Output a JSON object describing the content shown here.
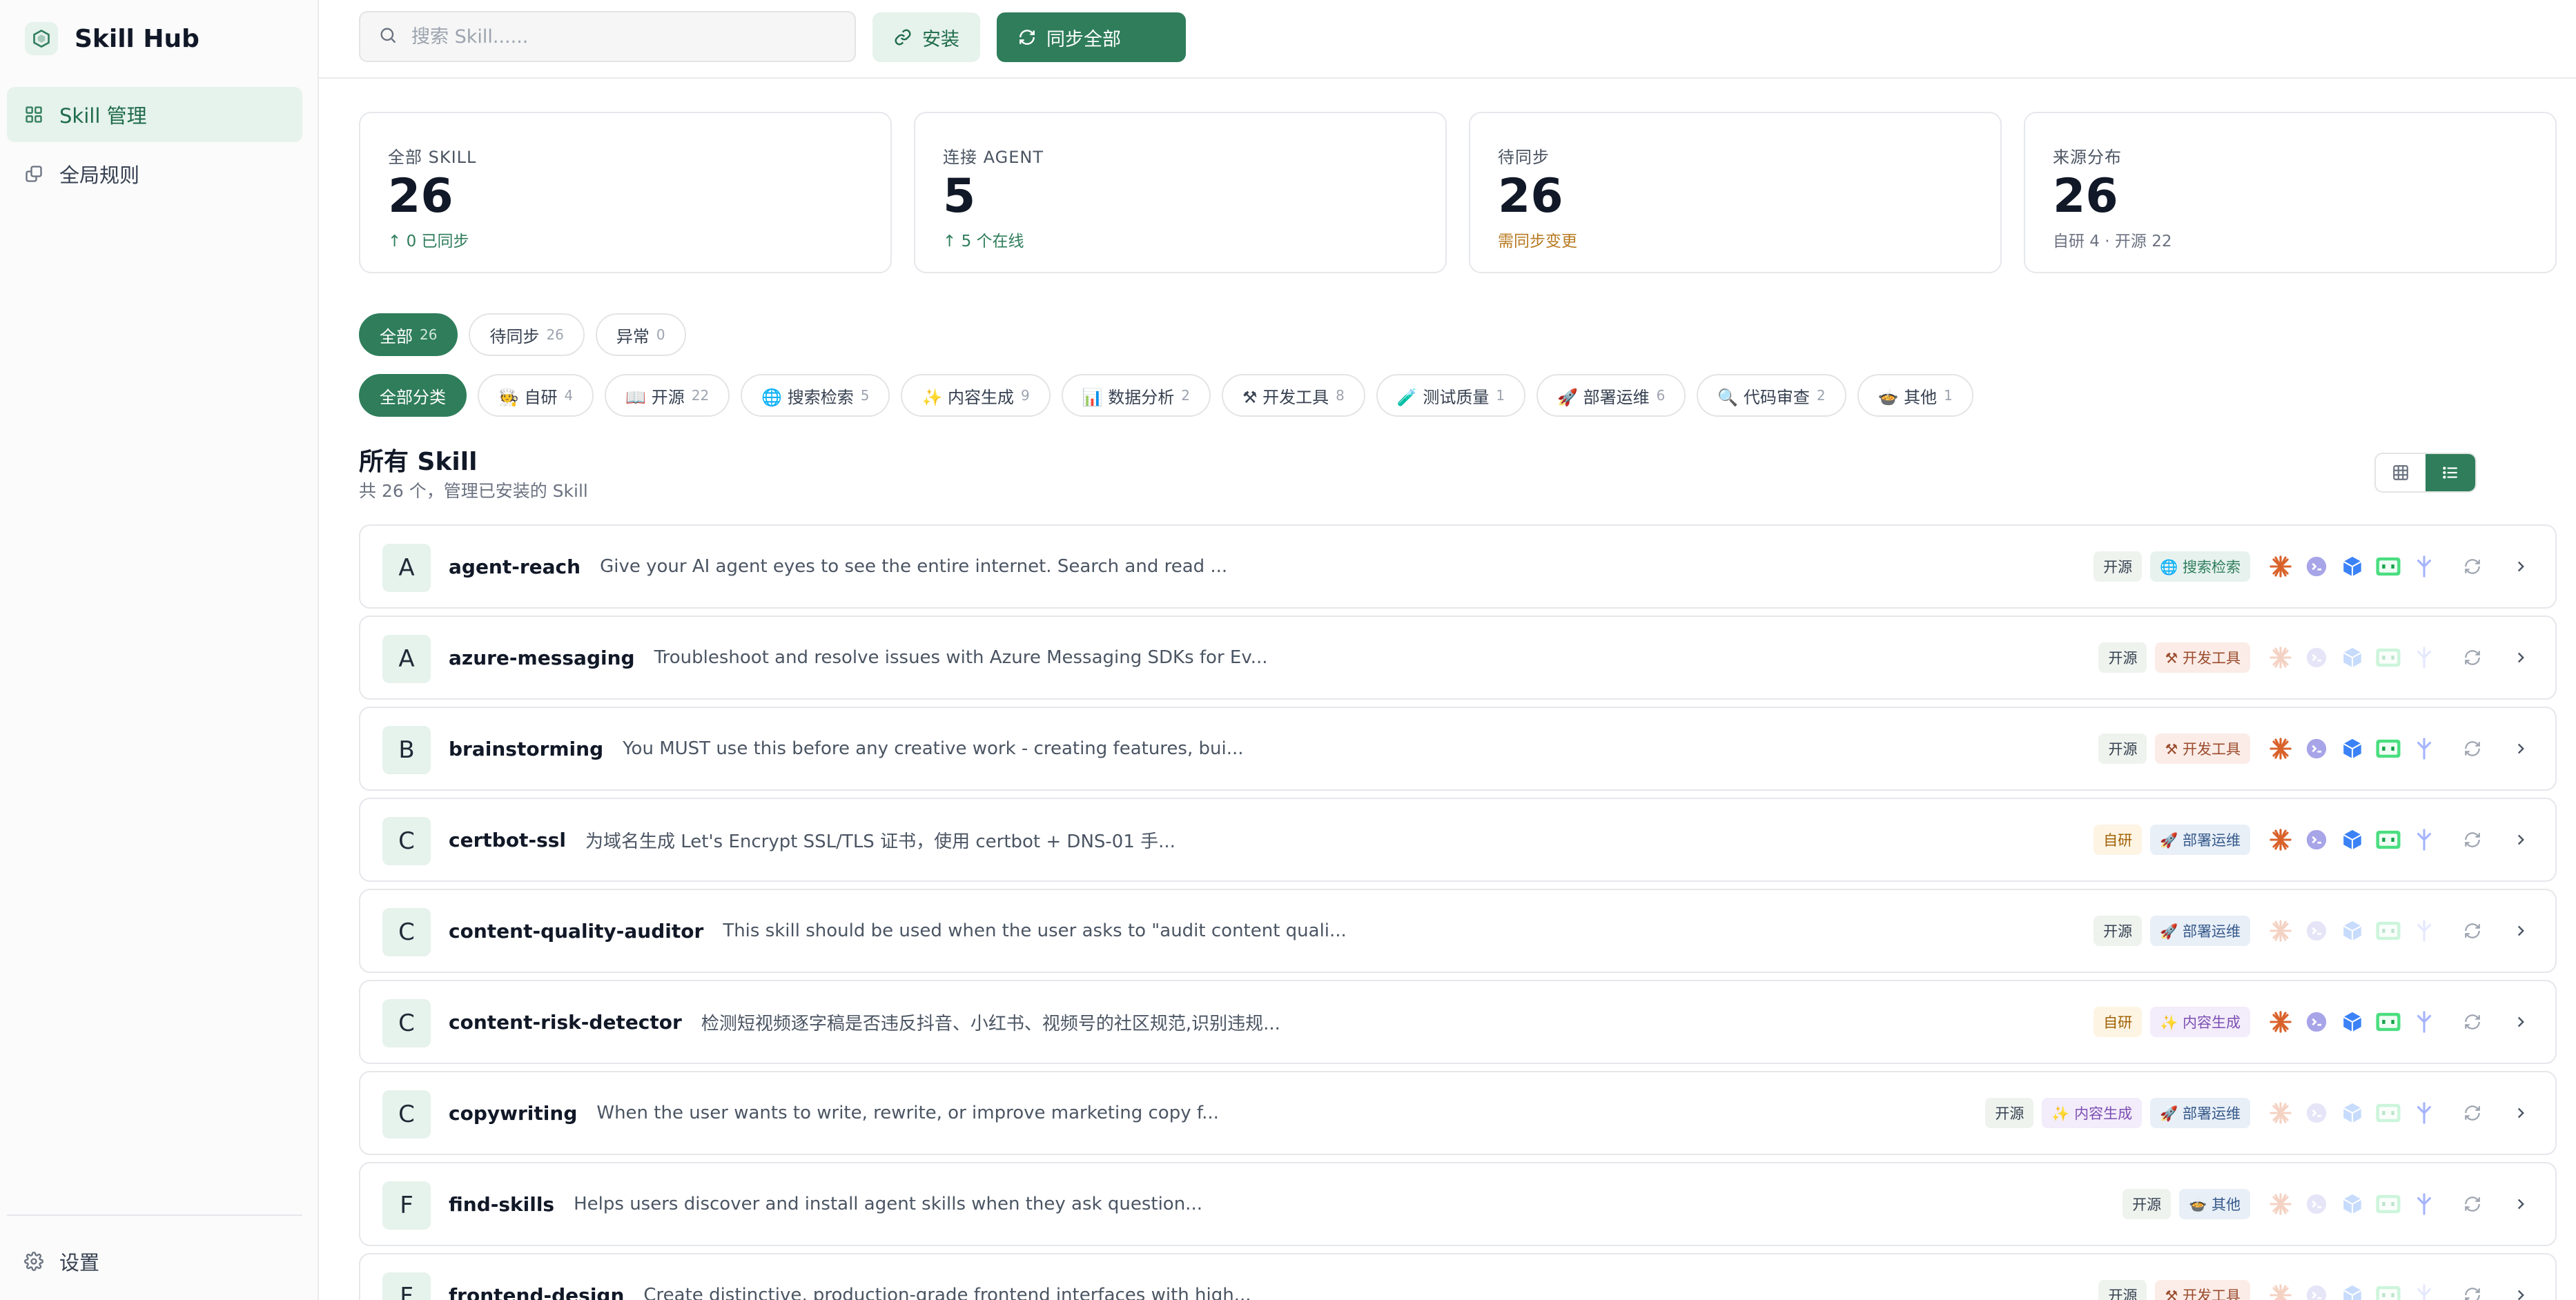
{
  "app": {
    "title": "Skill Hub"
  },
  "sidebar": {
    "items": [
      {
        "label": "Skill 管理",
        "icon": "grid-icon",
        "active": true
      },
      {
        "label": "全局规则",
        "icon": "copy-icon",
        "active": false
      }
    ],
    "footer": {
      "label": "设置",
      "icon": "gear-icon"
    }
  },
  "topbar": {
    "search_placeholder": "搜索 Skill......",
    "install_label": "安装",
    "sync_all_label": "同步全部"
  },
  "stats": [
    {
      "label": "全部 SKILL",
      "value": "26",
      "sub": "↑ 0 已同步",
      "tone": "green"
    },
    {
      "label": "连接 AGENT",
      "value": "5",
      "sub": "↑ 5 个在线",
      "tone": "green"
    },
    {
      "label": "待同步",
      "value": "26",
      "sub": "需同步变更",
      "tone": "amber"
    },
    {
      "label": "来源分布",
      "value": "26",
      "sub": "自研 4 · 开源 22",
      "tone": "gray"
    }
  ],
  "status_filters": [
    {
      "label": "全部",
      "count": "26",
      "active": true
    },
    {
      "label": "待同步",
      "count": "26",
      "active": false
    },
    {
      "label": "异常",
      "count": "0",
      "active": false
    }
  ],
  "category_filters": [
    {
      "label": "全部分类",
      "count": "",
      "active": true
    },
    {
      "label": "🧑‍🍳 自研",
      "count": "4"
    },
    {
      "label": "📖 开源",
      "count": "22"
    },
    {
      "label": "🌐 搜索检索",
      "count": "5"
    },
    {
      "label": "✨ 内容生成",
      "count": "9"
    },
    {
      "label": "📊 数据分析",
      "count": "2"
    },
    {
      "label": "⚒ 开发工具",
      "count": "8"
    },
    {
      "label": "🧪 测试质量",
      "count": "1"
    },
    {
      "label": "🚀 部署运维",
      "count": "6"
    },
    {
      "label": "🔍 代码审查",
      "count": "2"
    },
    {
      "label": "🍲 其他",
      "count": "1"
    }
  ],
  "section": {
    "title": "所有 Skill",
    "subtitle": "共 26 个，管理已安装的 Skill"
  },
  "skills": [
    {
      "initial": "A",
      "name": "agent-reach",
      "desc": "Give your AI agent eyes to see the entire internet. Search and read ...",
      "source": "开源",
      "source_type": "open",
      "categories": [
        {
          "label": "🌐 搜索检索",
          "type": "search"
        }
      ],
      "agents_on": [
        true,
        true,
        true,
        true,
        true
      ]
    },
    {
      "initial": "A",
      "name": "azure-messaging",
      "desc": "Troubleshoot and resolve issues with Azure Messaging SDKs for Ev...",
      "source": "开源",
      "source_type": "open",
      "categories": [
        {
          "label": "⚒ 开发工具",
          "type": "dev"
        }
      ],
      "agents_on": [
        false,
        false,
        false,
        false,
        false
      ]
    },
    {
      "initial": "B",
      "name": "brainstorming",
      "desc": "You MUST use this before any creative work - creating features, bui...",
      "source": "开源",
      "source_type": "open",
      "categories": [
        {
          "label": "⚒ 开发工具",
          "type": "dev"
        }
      ],
      "agents_on": [
        true,
        true,
        true,
        true,
        true
      ]
    },
    {
      "initial": "C",
      "name": "certbot-ssl",
      "desc": "为域名生成 Let's Encrypt SSL/TLS 证书，使用 certbot + DNS-01 手...",
      "source": "自研",
      "source_type": "self",
      "categories": [
        {
          "label": "🚀 部署运维",
          "type": "ops"
        }
      ],
      "agents_on": [
        true,
        true,
        true,
        true,
        true
      ]
    },
    {
      "initial": "C",
      "name": "content-quality-auditor",
      "desc": "This skill should be used when the user asks to \"audit content quali...",
      "source": "开源",
      "source_type": "open",
      "categories": [
        {
          "label": "🚀 部署运维",
          "type": "ops"
        }
      ],
      "agents_on": [
        false,
        false,
        false,
        false,
        false
      ]
    },
    {
      "initial": "C",
      "name": "content-risk-detector",
      "desc": "检测短视频逐字稿是否违反抖音、小红书、视频号的社区规范,识别违规...",
      "source": "自研",
      "source_type": "self",
      "categories": [
        {
          "label": "✨ 内容生成",
          "type": "content"
        }
      ],
      "agents_on": [
        true,
        true,
        true,
        true,
        true
      ]
    },
    {
      "initial": "C",
      "name": "copywriting",
      "desc": "When the user wants to write, rewrite, or improve marketing copy f...",
      "source": "开源",
      "source_type": "open",
      "categories": [
        {
          "label": "✨ 内容生成",
          "type": "content"
        },
        {
          "label": "🚀 部署运维",
          "type": "ops"
        }
      ],
      "agents_on": [
        false,
        false,
        false,
        false,
        true
      ]
    },
    {
      "initial": "F",
      "name": "find-skills",
      "desc": "Helps users discover and install agent skills when they ask question...",
      "source": "开源",
      "source_type": "open",
      "categories": [
        {
          "label": "🍲 其他",
          "type": "other"
        }
      ],
      "agents_on": [
        false,
        false,
        false,
        false,
        true
      ]
    },
    {
      "initial": "F",
      "name": "frontend-design",
      "desc": "Create distinctive, production-grade frontend interfaces with high...",
      "source": "开源",
      "source_type": "open",
      "categories": [
        {
          "label": "⚒ 开发工具",
          "type": "dev"
        }
      ],
      "agents_on": [
        false,
        false,
        false,
        false,
        false
      ]
    }
  ],
  "colors": {
    "accent": "#2f7d5b",
    "accent_soft": "#e6f2ec",
    "amber": "#b7791f"
  }
}
